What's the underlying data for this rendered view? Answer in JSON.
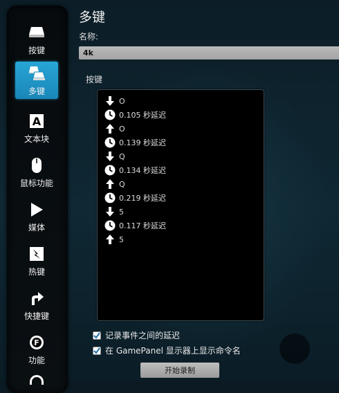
{
  "sidebar": {
    "items": [
      {
        "label": "按键",
        "icon": "key-icon"
      },
      {
        "label": "多键",
        "icon": "multikey-icon",
        "active": true
      },
      {
        "label": "文本块",
        "icon": "text-block-icon"
      },
      {
        "label": "鼠标功能",
        "icon": "mouse-icon"
      },
      {
        "label": "媒体",
        "icon": "play-icon"
      },
      {
        "label": "热键",
        "icon": "hotkey-icon"
      },
      {
        "label": "快捷键",
        "icon": "shortcut-arrow-icon"
      },
      {
        "label": "功能",
        "icon": "function-icon"
      }
    ]
  },
  "panel": {
    "title": "多键",
    "name_label": "名称:",
    "name_value": "4k",
    "keys_label": "按键",
    "events": [
      {
        "type": "down",
        "text": "O"
      },
      {
        "type": "delay",
        "text": "0.105 秒延迟"
      },
      {
        "type": "up",
        "text": "O"
      },
      {
        "type": "delay",
        "text": "0.139 秒延迟"
      },
      {
        "type": "down",
        "text": "Q"
      },
      {
        "type": "delay",
        "text": "0.134 秒延迟"
      },
      {
        "type": "up",
        "text": "Q"
      },
      {
        "type": "delay",
        "text": "0.219 秒延迟"
      },
      {
        "type": "down",
        "text": "5"
      },
      {
        "type": "delay",
        "text": "0.117 秒延迟"
      },
      {
        "type": "up",
        "text": "5"
      }
    ],
    "checkbox_delay": "记录事件之间的延迟",
    "checkbox_gamepanel": "在 GamePanel 显示器上显示命令名",
    "record_button": "开始录制"
  },
  "colors": {
    "accent": "#1f95c8",
    "list_bg": "#000000"
  }
}
